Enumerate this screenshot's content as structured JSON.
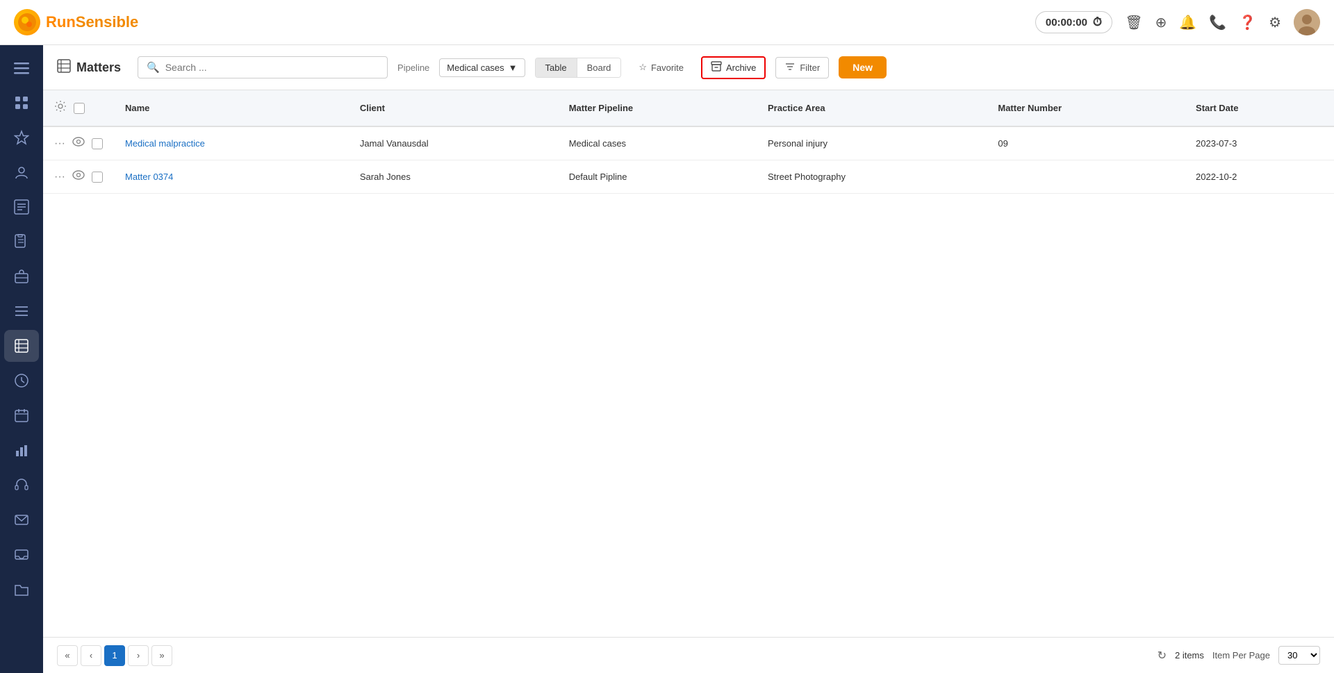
{
  "logo": {
    "icon": "●",
    "text_run": "Run",
    "text_sensible": "Sensible"
  },
  "timer": {
    "display": "00:00:00"
  },
  "sidebar": {
    "items": [
      {
        "name": "menu-icon",
        "icon": "☰"
      },
      {
        "name": "dashboard-icon",
        "icon": "⊞"
      },
      {
        "name": "star-icon",
        "icon": "☆"
      },
      {
        "name": "contacts-icon",
        "icon": "👤"
      },
      {
        "name": "reports-icon",
        "icon": "📊"
      },
      {
        "name": "notes-icon",
        "icon": "📋"
      },
      {
        "name": "briefcase-icon",
        "icon": "💼"
      },
      {
        "name": "list-icon",
        "icon": "☰"
      },
      {
        "name": "matters-icon",
        "icon": "🗂"
      },
      {
        "name": "clock-icon",
        "icon": "⏰"
      },
      {
        "name": "calendar-icon",
        "icon": "📅"
      },
      {
        "name": "analytics-icon",
        "icon": "📈"
      },
      {
        "name": "headset-icon",
        "icon": "🎧"
      },
      {
        "name": "email-icon",
        "icon": "✉"
      },
      {
        "name": "inbox-icon",
        "icon": "📨"
      },
      {
        "name": "folder-icon",
        "icon": "📁"
      }
    ]
  },
  "subheader": {
    "page_title": "Matters",
    "page_title_icon": "⊞",
    "search_placeholder": "Search ...",
    "pipeline_label": "Pipeline",
    "pipeline_value": "Medical cases",
    "view_table": "Table",
    "view_board": "Board",
    "favorite_label": "Favorite",
    "archive_label": "Archive",
    "filter_label": "Filter",
    "new_label": "New"
  },
  "table": {
    "columns": [
      "Name",
      "Client",
      "Matter Pipeline",
      "Practice Area",
      "Matter Number",
      "Start Date"
    ],
    "rows": [
      {
        "name": "Medical malpractice",
        "client": "Jamal Vanausdal",
        "pipeline": "Medical cases",
        "practice_area": "Personal injury",
        "matter_number": "09",
        "start_date": "2023-07-3"
      },
      {
        "name": "Matter 0374",
        "client": "Sarah Jones",
        "pipeline": "Default Pipline",
        "practice_area": "Street Photography",
        "matter_number": "",
        "start_date": "2022-10-2"
      }
    ]
  },
  "footer": {
    "first_page": "«",
    "prev_page": "‹",
    "current_page": "1",
    "next_page": "›",
    "last_page": "»",
    "items_count": "2 items",
    "per_page_label": "Item Per Page",
    "per_page_value": "30"
  }
}
